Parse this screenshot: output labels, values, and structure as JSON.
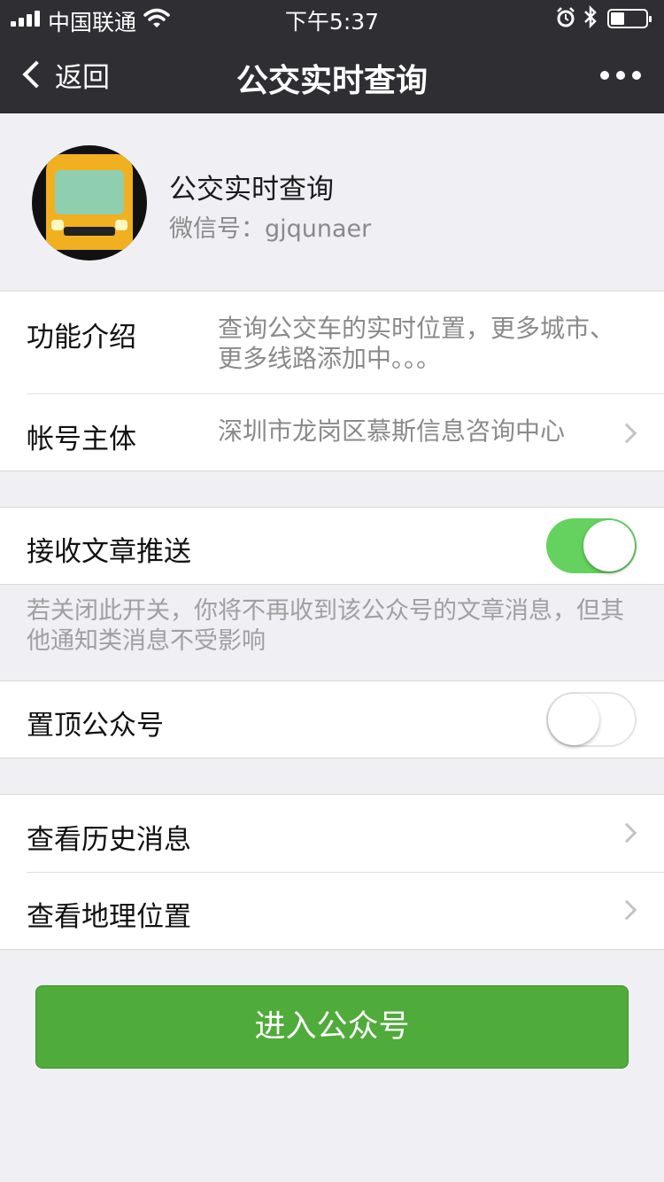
{
  "status_bar": {
    "carrier": "中国联通",
    "time": "下午5:37",
    "battery_level": 0.4
  },
  "nav": {
    "back_label": "返回",
    "title": "公交实时查询"
  },
  "profile": {
    "name": "公交实时查询",
    "wechat_id": "微信号：gjqunaer"
  },
  "info": {
    "intro_label": "功能介绍",
    "intro_value": "查询公交车的实时位置，更多城市、更多线路添加中。。。",
    "account_label": "帐号主体",
    "account_value": "深圳市龙岗区慕斯信息咨询中心"
  },
  "push": {
    "label": "接收文章推送",
    "enabled": true,
    "note": "若关闭此开关，你将不再收到该公众号的文章消息，但其他通知类消息不受影响"
  },
  "pin": {
    "label": "置顶公众号",
    "enabled": false
  },
  "links": {
    "history_label": "查看历史消息",
    "location_label": "查看地理位置"
  },
  "enter_button": "进入公众号",
  "colors": {
    "nav_bg": "#2e2e33",
    "switch_on": "#65d15f",
    "primary_button": "#4fab3a",
    "page_bg": "#efeff4"
  }
}
